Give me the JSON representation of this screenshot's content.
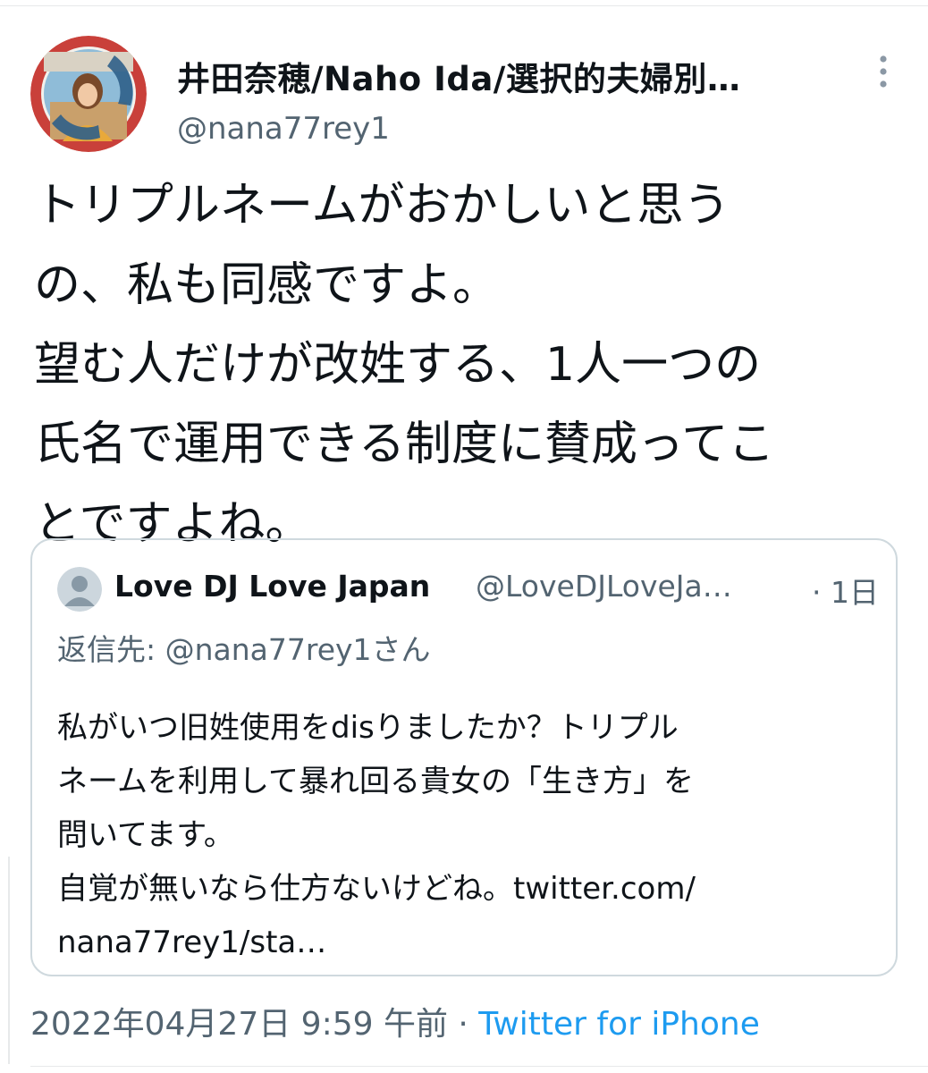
{
  "tweet": {
    "author": {
      "display_name": "井田奈穂/Naho Ida/選択的夫婦別…",
      "handle": "@nana77rey1",
      "avatar_icon": "profile-photo-icon"
    },
    "more_icon": "more-vertical-icon",
    "text": "トリプルネームがおかしいと思う\nの、私も同感ですよ。\n望む人だけが改姓する、1人一つの\n氏名で運用できる制度に賛成ってこ\nとですよね。",
    "timestamp": "2022年04月27日 9:59 午前 · ",
    "source": "Twitter for iPhone"
  },
  "quoted_tweet": {
    "display_name": "Love DJ Love Japan",
    "handle": "@LoveDJLoveJa…",
    "time": "· 1日",
    "reply_to": "返信先: @nana77rey1さん",
    "text": "私がいつ旧姓使用をdisりましたか？トリプル\nネームを利用して暴れ回る貴女の「生き方」を\n問いてます。\n自覚が無いなら仕方ないけどね。twitter.com/\nnana77rey1/sta…",
    "avatar_icon": "default-avatar-icon"
  },
  "colors": {
    "text": "#0f1419",
    "secondary": "#536471",
    "link": "#1d9bf0",
    "border": "#cfd9de"
  }
}
